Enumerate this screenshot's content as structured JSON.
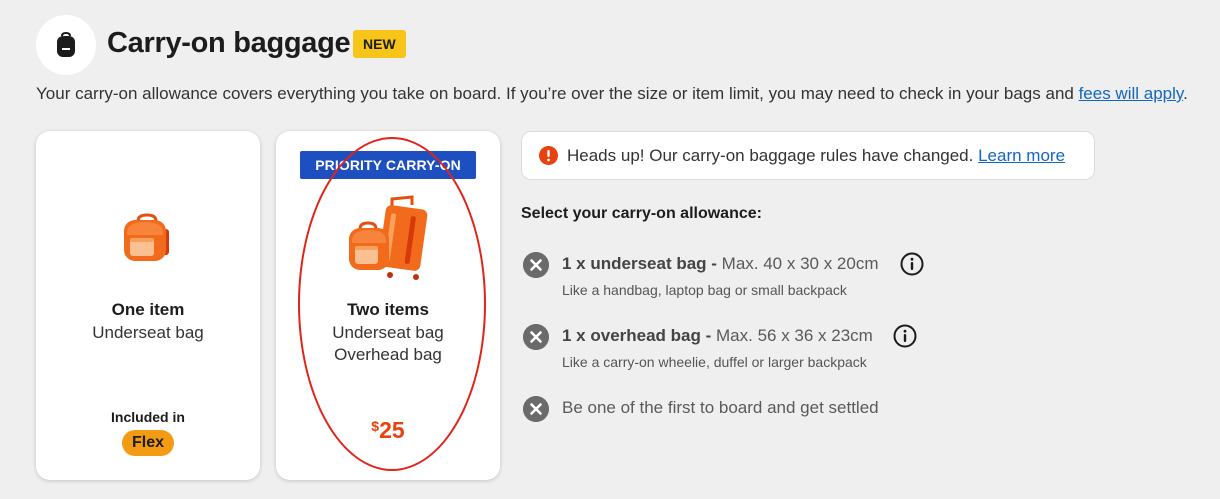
{
  "header": {
    "icon": "backpack-icon",
    "title": "Carry-on baggage",
    "badge": "NEW"
  },
  "intro": {
    "text": "Your carry-on allowance covers everything you take on board. If you’re over the size or item limit, you may need to check in your bags and ",
    "link": "fees will apply",
    "end": "."
  },
  "cards": {
    "one": {
      "icon": "backpack-orange-icon",
      "title": "One item",
      "line1": "Underseat bag",
      "included_label": "Included in",
      "fare": "Flex"
    },
    "two": {
      "banner": "PRIORITY CARRY-ON",
      "icon": "backpack-and-suitcase-icon",
      "title": "Two items",
      "line1": "Underseat bag",
      "line2": "Overhead bag",
      "currency": "$",
      "price": "25"
    }
  },
  "notice": {
    "icon": "alert-icon",
    "text": "Heads up! Our carry-on baggage rules have changed. ",
    "link": "Learn more"
  },
  "allowance": {
    "heading": "Select your carry-on allowance:",
    "items": [
      {
        "icon": "x-circle-icon",
        "bold": "1 x underseat bag -",
        "rest": " Max. 40 x 30 x 20cm",
        "sub": "Like a handbag, laptop bag or small backpack"
      },
      {
        "icon": "x-circle-icon",
        "bold": "1 x overhead bag -",
        "rest": " Max. 56 x 36 x 23cm",
        "sub": "Like a carry-on wheelie, duffel or larger backpack"
      },
      {
        "icon": "x-circle-icon",
        "text": "Be one of the first to board and get settled"
      }
    ]
  },
  "colors": {
    "background": "#efefef",
    "badge": "#f7c518",
    "priority_blue": "#1e4fc0",
    "price_orange": "#e8420e",
    "flex_pill": "#f39b12",
    "link_blue": "#1466c3",
    "annotation_red": "#e2231a"
  }
}
